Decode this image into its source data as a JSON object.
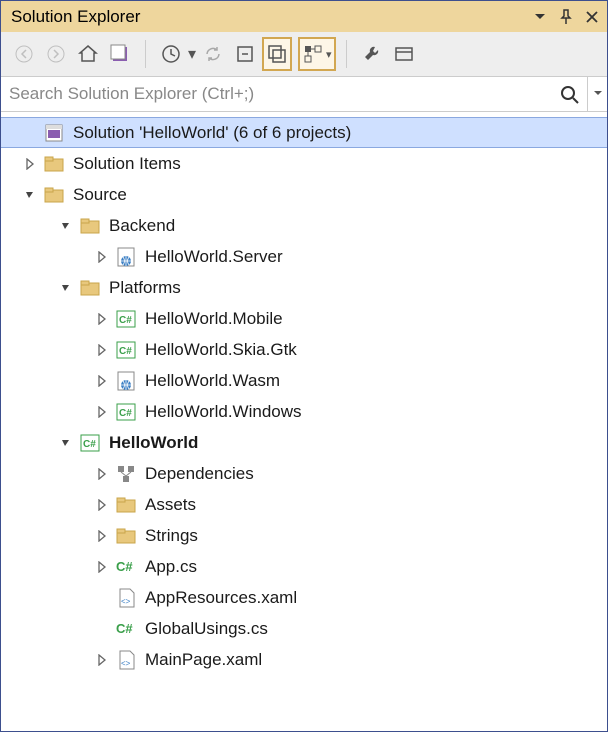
{
  "title": "Solution Explorer",
  "search": {
    "placeholder": "Search Solution Explorer (Ctrl+;)"
  },
  "toolbar": {
    "back": "back-icon",
    "forward": "forward-icon",
    "home": "home-icon",
    "scope": "scope-icon",
    "history": "history-icon",
    "sync": "sync-icon",
    "collapse": "collapse-all-icon",
    "showall": "show-all-icon",
    "view": "view-icon",
    "props": "properties-icon",
    "preview": "preview-icon"
  },
  "tree": [
    {
      "depth": 0,
      "exp": null,
      "icon": "solution",
      "label": "Solution 'HelloWorld' (6 of 6 projects)",
      "selected": true
    },
    {
      "depth": 0,
      "exp": "closed",
      "icon": "folder",
      "label": "Solution Items"
    },
    {
      "depth": 0,
      "exp": "open",
      "icon": "folder",
      "label": "Source"
    },
    {
      "depth": 1,
      "exp": "open",
      "icon": "folder",
      "label": "Backend"
    },
    {
      "depth": 2,
      "exp": "closed",
      "icon": "web",
      "label": "HelloWorld.Server"
    },
    {
      "depth": 1,
      "exp": "open",
      "icon": "folder",
      "label": "Platforms"
    },
    {
      "depth": 2,
      "exp": "closed",
      "icon": "cs",
      "label": "HelloWorld.Mobile"
    },
    {
      "depth": 2,
      "exp": "closed",
      "icon": "cs",
      "label": "HelloWorld.Skia.Gtk"
    },
    {
      "depth": 2,
      "exp": "closed",
      "icon": "web",
      "label": "HelloWorld.Wasm"
    },
    {
      "depth": 2,
      "exp": "closed",
      "icon": "cs",
      "label": "HelloWorld.Windows"
    },
    {
      "depth": 1,
      "exp": "open",
      "icon": "cs",
      "label": "HelloWorld",
      "bold": true
    },
    {
      "depth": 2,
      "exp": "closed",
      "icon": "deps",
      "label": "Dependencies"
    },
    {
      "depth": 2,
      "exp": "closed",
      "icon": "folder",
      "label": "Assets"
    },
    {
      "depth": 2,
      "exp": "closed",
      "icon": "folder",
      "label": "Strings"
    },
    {
      "depth": 2,
      "exp": "closed",
      "icon": "csfile",
      "label": "App.cs"
    },
    {
      "depth": 2,
      "exp": null,
      "icon": "xaml",
      "label": "AppResources.xaml"
    },
    {
      "depth": 2,
      "exp": null,
      "icon": "csfile",
      "label": "GlobalUsings.cs"
    },
    {
      "depth": 2,
      "exp": "closed",
      "icon": "xaml",
      "label": "MainPage.xaml"
    }
  ]
}
